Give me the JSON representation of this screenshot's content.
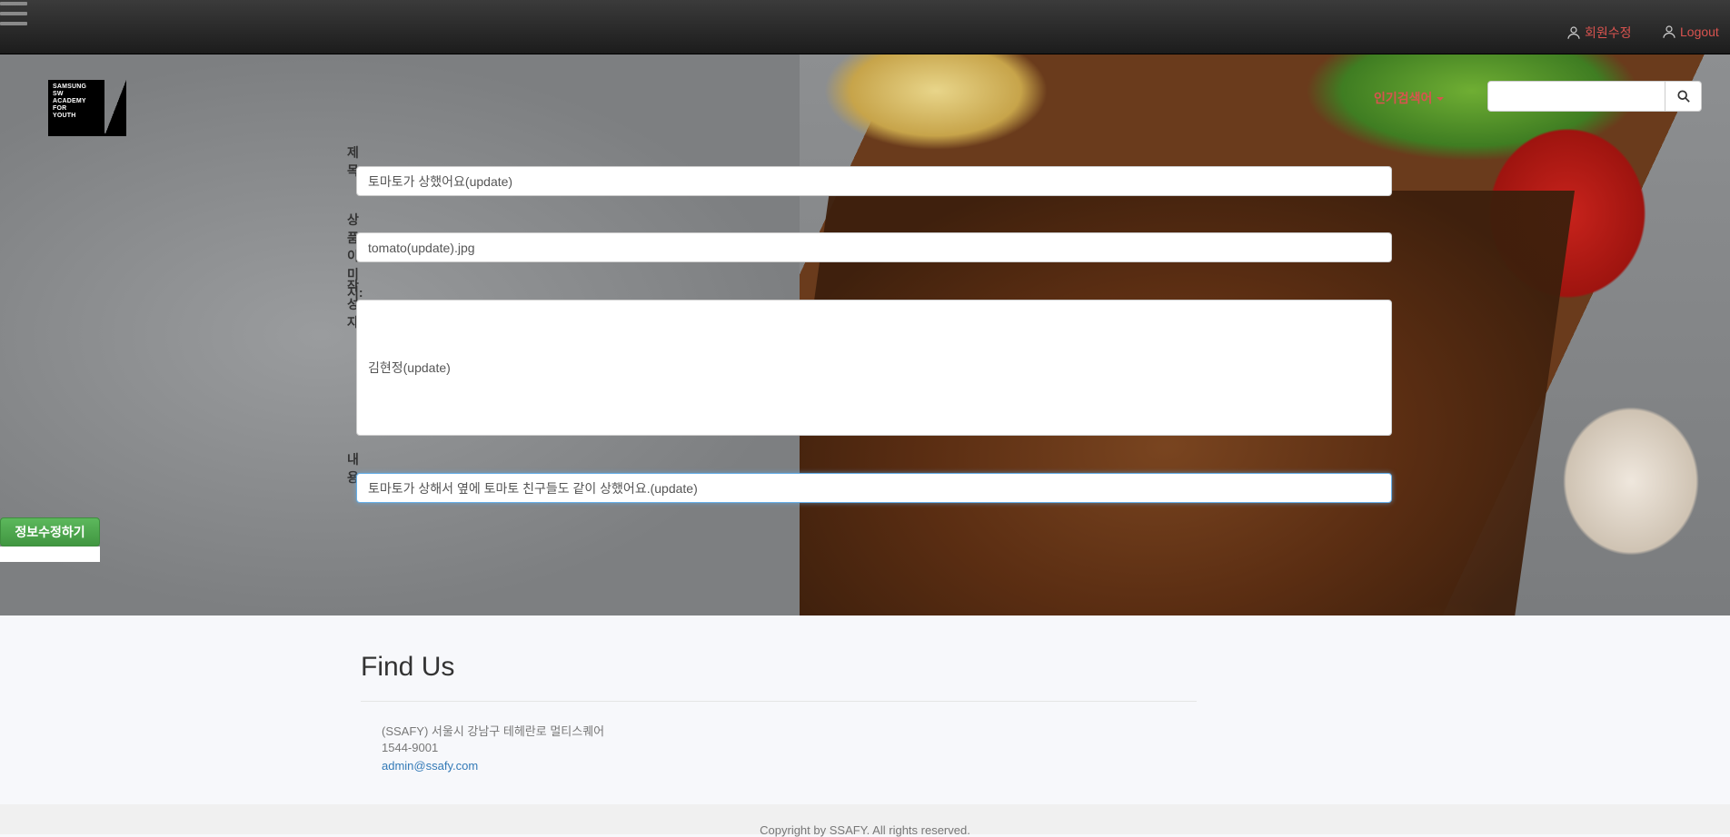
{
  "navbar": {
    "links": [
      {
        "label": "회원수정",
        "icon": "user-icon"
      },
      {
        "label": "Logout",
        "icon": "user-icon"
      }
    ]
  },
  "logo": {
    "lines": [
      "SAMSUNG",
      "SW",
      "ACADEMY",
      "FOR",
      "YOUTH"
    ]
  },
  "search": {
    "dropdown_label": "인기검색어",
    "placeholder": ""
  },
  "form": {
    "title_label": "제목:",
    "title_value": "토마토가 상했어요(update)",
    "image_label": "상품이미지:",
    "image_value": "tomato(update).jpg",
    "author_label": "작성자:",
    "author_value": "김현정(update)",
    "content_label": "내용:",
    "content_value": "토마토가 상해서 옆에 토마토 친구들도 같이 상했어요.(update)",
    "submit_label": "정보수정하기"
  },
  "findus": {
    "title": "Find Us",
    "address": "(SSAFY) 서울시 강남구 테헤란로 멀티스퀘어",
    "phone": "1544-9001",
    "email": "admin@ssafy.com"
  },
  "footer": {
    "copyright": "Copyright by SSAFY. All rights reserved."
  },
  "colors": {
    "accent": "#d9534f",
    "success": "#5cb85c",
    "link": "#337ab7"
  }
}
